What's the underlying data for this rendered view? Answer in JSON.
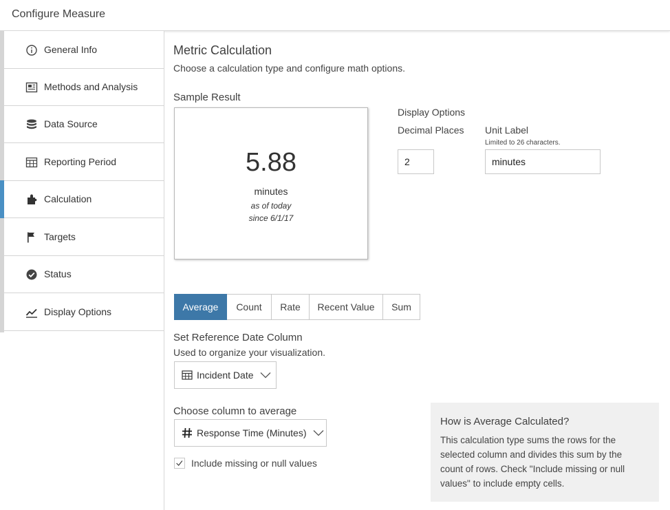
{
  "header": {
    "title": "Configure Measure"
  },
  "sidebar": {
    "items": [
      {
        "label": "General Info",
        "icon": "info-circle-icon"
      },
      {
        "label": "Methods and Analysis",
        "icon": "document-icon"
      },
      {
        "label": "Data Source",
        "icon": "database-icon"
      },
      {
        "label": "Reporting Period",
        "icon": "calendar-icon"
      },
      {
        "label": "Calculation",
        "icon": "puzzle-icon",
        "active": true
      },
      {
        "label": "Targets",
        "icon": "flag-icon"
      },
      {
        "label": "Status",
        "icon": "check-circle-icon"
      },
      {
        "label": "Display Options",
        "icon": "line-chart-icon"
      }
    ]
  },
  "main": {
    "title": "Metric Calculation",
    "subtitle": "Choose a calculation type and configure math options.",
    "sample": {
      "heading": "Sample Result",
      "value": "5.88",
      "unit": "minutes",
      "as_of": "as of today",
      "since": "since 6/1/17"
    },
    "display_options": {
      "heading": "Display Options",
      "decimal_label": "Decimal Places",
      "decimal_value": "2",
      "unit_label": "Unit Label",
      "unit_hint": "Limited to 26 characters.",
      "unit_value": "minutes"
    },
    "tabs": [
      "Average",
      "Count",
      "Rate",
      "Recent Value",
      "Sum"
    ],
    "active_tab": "Average",
    "reference": {
      "heading": "Set Reference Date Column",
      "description": "Used to organize your visualization.",
      "selected": "Incident Date"
    },
    "column": {
      "heading": "Choose column to average",
      "selected": "Response Time (Minutes)"
    },
    "include_null": {
      "label": "Include missing or null values",
      "checked": true
    },
    "info": {
      "title": "How is Average Calculated?",
      "body": "This calculation type sums the rows for the selected column and divides this sum by the count of rows. Check \"Include missing or null values\" to include empty cells."
    }
  },
  "colors": {
    "accent": "#3d78a8",
    "active_rail": "#4a90c4",
    "info_bg": "#f0f0f0"
  }
}
